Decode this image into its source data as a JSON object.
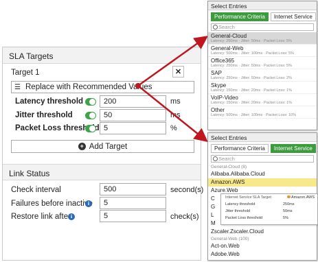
{
  "sla_targets": {
    "header": "SLA Targets",
    "target_title": "Target 1",
    "replace_button": "Replace with Recommended Values",
    "latency": {
      "label": "Latency threshold",
      "value": "200",
      "unit": "ms"
    },
    "jitter": {
      "label": "Jitter threshold",
      "value": "50",
      "unit": "ms"
    },
    "packet_loss": {
      "label": "Packet Loss threshold",
      "value": "5",
      "unit": "%"
    },
    "add_target": "Add Target"
  },
  "link_status": {
    "header": "Link Status",
    "check_interval": {
      "label": "Check interval",
      "value": "500",
      "unit": "second(s)"
    },
    "failures": {
      "label": "Failures before inactive",
      "value": "5"
    },
    "restore": {
      "label": "Restore link after",
      "value": "5",
      "unit": "check(s)"
    }
  },
  "popup1": {
    "title": "Select Entries",
    "tabs": [
      "Performance Criteria",
      "Internet Service"
    ],
    "search_placeholder": "Search",
    "entries": [
      {
        "name": "General-Cloud",
        "desc": "Latency: 250ms · Jitter: 50ms · Packet Loss: 5%"
      },
      {
        "name": "General-Web",
        "desc": "Latency: 500ms · Jitter: 100ms · Packet Loss: 5%"
      },
      {
        "name": "Office365",
        "desc": "Latency: 250ms · Jitter: 50ms · Packet Loss: 5%"
      },
      {
        "name": "SAP",
        "desc": "Latency: 250ms · Jitter: 50ms · Packet Loss: 2%"
      },
      {
        "name": "Skype",
        "desc": "Latency: 150ms · Jitter: 20ms · Packet Loss: 1%"
      },
      {
        "name": "VoIP-Video",
        "desc": "Latency: 150ms · Jitter: 20ms · Packet Loss: 1%"
      },
      {
        "name": "Other",
        "desc": "Latency: 500ms · Jitter: 100ms · Packet Loss: 10%"
      }
    ]
  },
  "popup2": {
    "title": "Select Entries",
    "tabs": [
      "Performance Criteria",
      "Internet Service"
    ],
    "search_placeholder": "Search",
    "group1": "General-Cloud (8)",
    "services": [
      "Alibaba.Alibaba.Cloud",
      "Amazon.AWS",
      "Azure.Web",
      "C",
      "G",
      "L",
      "M",
      "Zscaler.Zscaler.Cloud"
    ],
    "group2": "General-Web (100)",
    "services2": [
      "Act-on.Web",
      "Adobe.Web"
    ]
  },
  "tooltip": {
    "title": "Internet Service SLA Target",
    "service": "Amazon.AWS",
    "rows": [
      {
        "label": "Latency threshold",
        "value": "250ms"
      },
      {
        "label": "Jitter threshold",
        "value": "50ms"
      },
      {
        "label": "Packet Loss threshold",
        "value": "5%"
      }
    ]
  },
  "colors": {
    "accent": "#3b9b3d",
    "arrow": "#c0161f",
    "highlight": "#f7e98a",
    "info": "#2b6ab4"
  }
}
